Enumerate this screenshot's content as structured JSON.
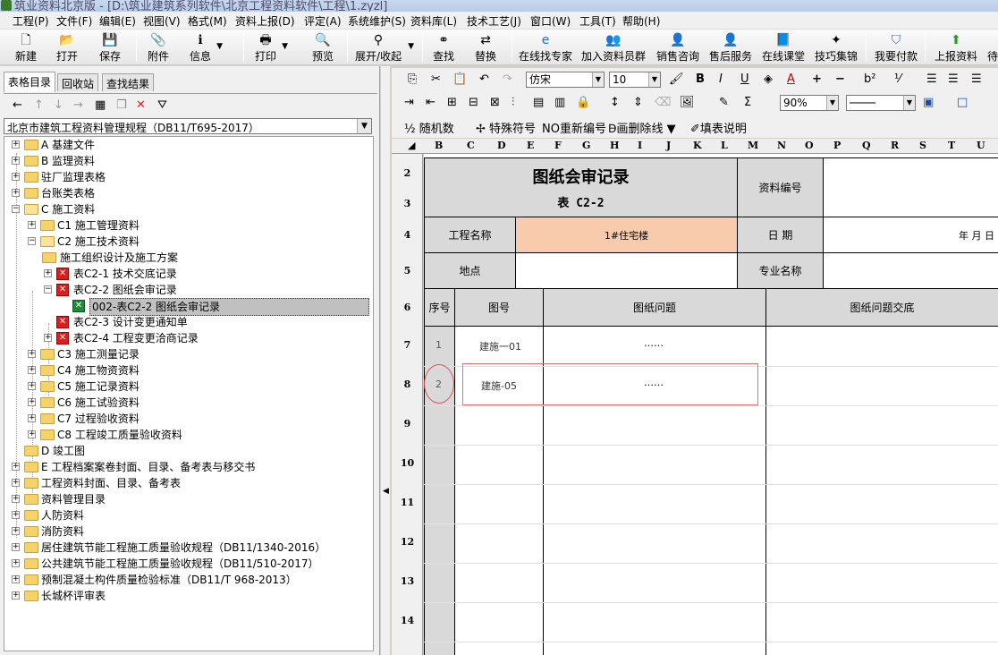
{
  "window": {
    "title": "筑业资料北京版 - [D:\\筑业建筑系列软件\\北京工程资料软件\\工程\\1.zyzl]"
  },
  "menu": [
    "工程(P)",
    "文件(F)",
    "编辑(E)",
    "视图(V)",
    "格式(M)",
    "资料上报(D)",
    "评定(A)",
    "系统维护(S)",
    "资料库(L)",
    "技术工艺(J)",
    "窗口(W)",
    "工具(T)",
    "帮助(H)"
  ],
  "toolbar": {
    "new": "新建",
    "open": "打开",
    "save": "保存",
    "attach": "附件",
    "info": "信息",
    "print": "打印",
    "preview": "预览",
    "expand": "展开/收起",
    "find": "查找",
    "replace": "替换",
    "online_expert": "在线找专家",
    "join_group": "加入资料员群",
    "sales": "销售咨询",
    "after_sales": "售后服务",
    "online_class": "在线课堂",
    "tips": "技巧集锦",
    "pay": "我要付款",
    "upload": "上报资料",
    "more": "待"
  },
  "left": {
    "tabs": [
      "表格目录",
      "回收站",
      "查找结果"
    ],
    "standard": "北京市建筑工程资料管理规程（DB11/T695-2017）",
    "tree": [
      {
        "label": "A 基建文件"
      },
      {
        "label": "B 监理资料"
      },
      {
        "label": "驻厂监理表格"
      },
      {
        "label": "台账类表格"
      },
      {
        "label": "C 施工资料"
      },
      {
        "label": "C1 施工管理资料"
      },
      {
        "label": "C2 施工技术资料"
      },
      {
        "label": "施工组织设计及施工方案"
      },
      {
        "label": "表C2-1 技术交底记录"
      },
      {
        "label": "表C2-2 图纸会审记录"
      },
      {
        "label": "002-表C2-2 图纸会审记录"
      },
      {
        "label": "表C2-3 设计变更通知单"
      },
      {
        "label": "表C2-4 工程变更洽商记录"
      },
      {
        "label": "C3 施工测量记录"
      },
      {
        "label": "C4 施工物资资料"
      },
      {
        "label": "C5 施工记录资料"
      },
      {
        "label": "C6 施工试验资料"
      },
      {
        "label": "C7 过程验收资料"
      },
      {
        "label": "C8 工程竣工质量验收资料"
      },
      {
        "label": "D 竣工图"
      },
      {
        "label": "E 工程档案案卷封面、目录、备考表与移交书"
      },
      {
        "label": "工程资料封面、目录、备考表"
      },
      {
        "label": "资料管理目录"
      },
      {
        "label": "人防资料"
      },
      {
        "label": "消防资料"
      },
      {
        "label": "居住建筑节能工程施工质量验收规程（DB11/1340-2016）"
      },
      {
        "label": "公共建筑节能工程施工质量验收规程（DB11/510-2017）"
      },
      {
        "label": "预制混凝土构件质量检验标准（DB11/T 968-2013）"
      },
      {
        "label": "长城杯评审表"
      }
    ]
  },
  "format": {
    "font": "仿宋",
    "size": "10",
    "zoom": "90%",
    "random": "随机数",
    "special": "特殊符号",
    "renumber": "重新编号",
    "strike": "画删除线",
    "fill_help": "填表说明",
    "bold": "B",
    "italic": "I",
    "underline": "U",
    "font_color": "A",
    "sup": "b²"
  },
  "columns": [
    "B",
    "C",
    "D",
    "E",
    "F",
    "G",
    "H",
    "I",
    "J",
    "K",
    "L",
    "M",
    "N",
    "O",
    "P",
    "Q",
    "R",
    "S",
    "T",
    "U"
  ],
  "rows": [
    "2",
    "3",
    "4",
    "5",
    "6",
    "7",
    "8",
    "9",
    "10",
    "11",
    "12",
    "13",
    "14"
  ],
  "form": {
    "title": "图纸会审记录",
    "subtitle": "表 C2-2",
    "doc_no_label": "资料编号",
    "project_label": "工程名称",
    "project_value": "1#住宅楼",
    "date_label": "日  期",
    "date_value": "年  月  日",
    "location_label": "地点",
    "specialty_label": "专业名称",
    "headers": [
      "序号",
      "图号",
      "图纸问题",
      "图纸问题交底"
    ],
    "rows": [
      {
        "no": "1",
        "drawing": "建施一01",
        "issue": "……"
      },
      {
        "no": "2",
        "drawing": "建施-05",
        "issue": "……"
      }
    ]
  },
  "colors": {
    "accent_peach": "#f8cbad",
    "header_grey": "#d9d9d9",
    "annotation": "#e05050"
  }
}
